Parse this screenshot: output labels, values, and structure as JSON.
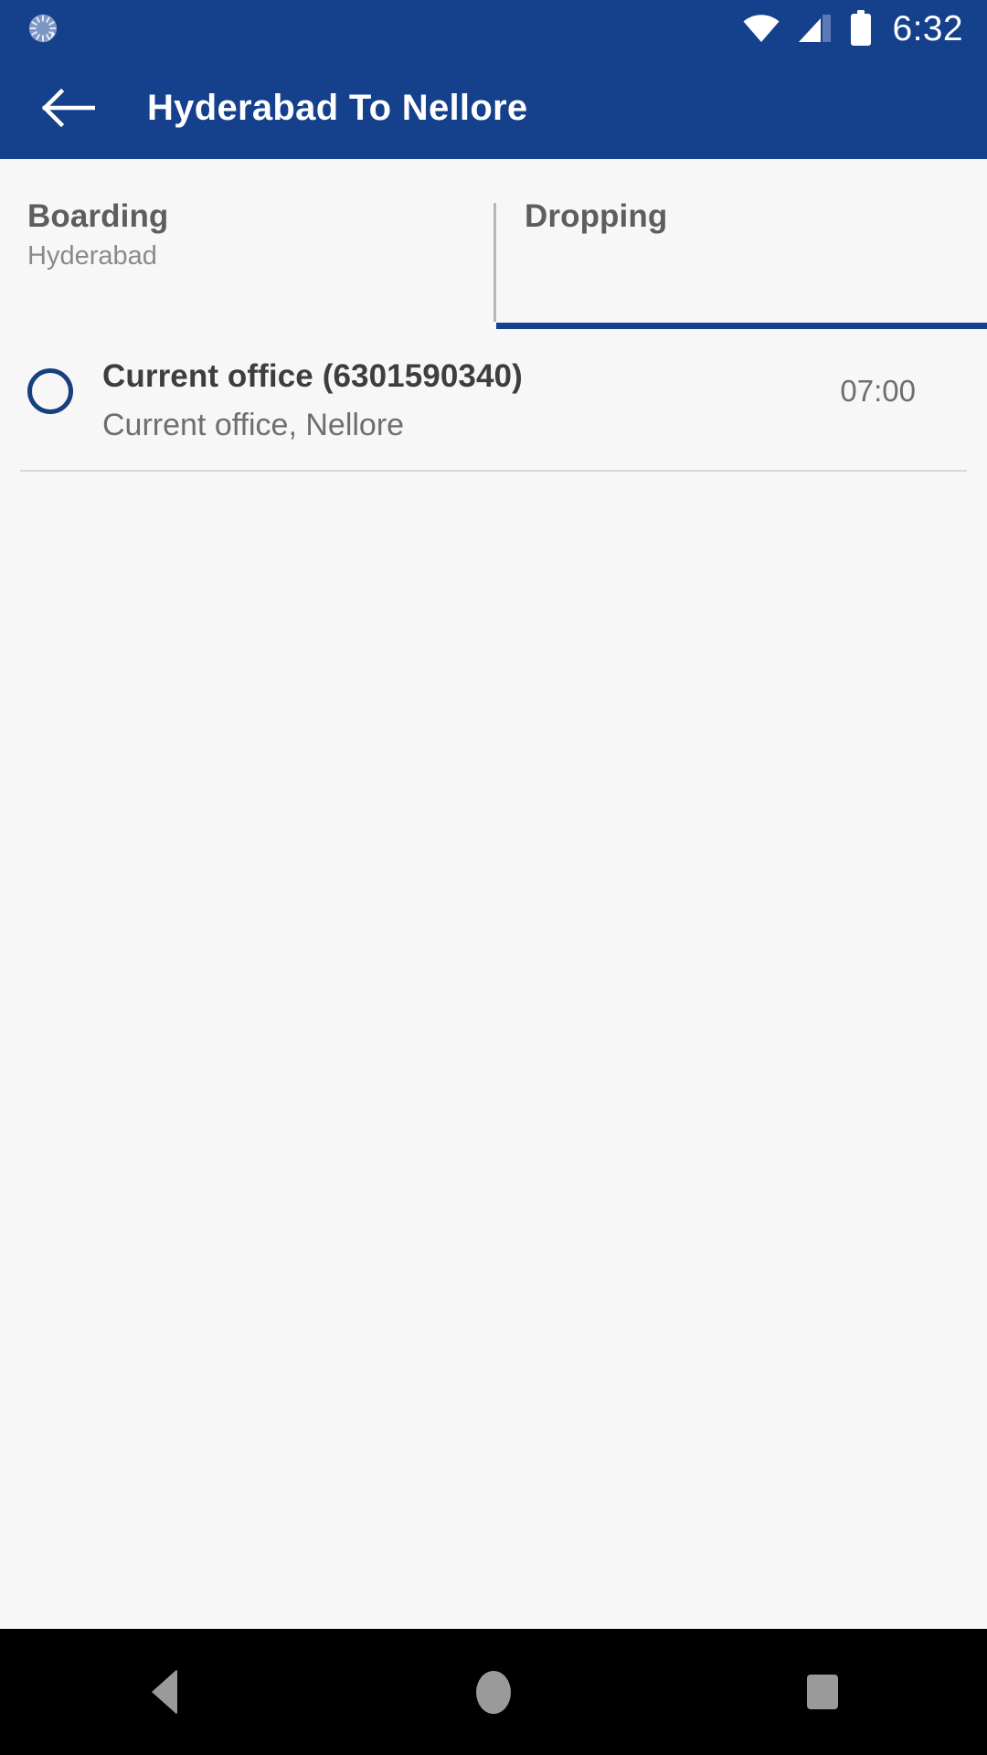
{
  "status_bar": {
    "sync_icon": "sync-spinner-icon",
    "wifi_icon": "wifi-icon",
    "signal_icon": "cellular-signal-icon",
    "battery_icon": "battery-icon",
    "time": "6:32",
    "background_color": "#14408C"
  },
  "app_bar": {
    "back_icon": "arrow-left-icon",
    "title": "Hyderabad  To  Nellore",
    "background_color": "#14408C",
    "text_color": "#FFFFFF"
  },
  "tabs": {
    "active_index": 1,
    "indicator_color": "#14408C",
    "items": [
      {
        "label": "Boarding",
        "sublabel": "Hyderabad",
        "selected": false
      },
      {
        "label": "Dropping",
        "sublabel": "",
        "selected": true
      }
    ]
  },
  "list": {
    "items": [
      {
        "selected": false,
        "title": "Current office (6301590340)",
        "subtitle": "Current office, Nellore",
        "time": "07:00"
      }
    ]
  },
  "nav_bar": {
    "back_label": "back-triangle-icon",
    "home_label": "home-circle-icon",
    "recents_label": "recents-square-icon",
    "background_color": "#000000"
  }
}
